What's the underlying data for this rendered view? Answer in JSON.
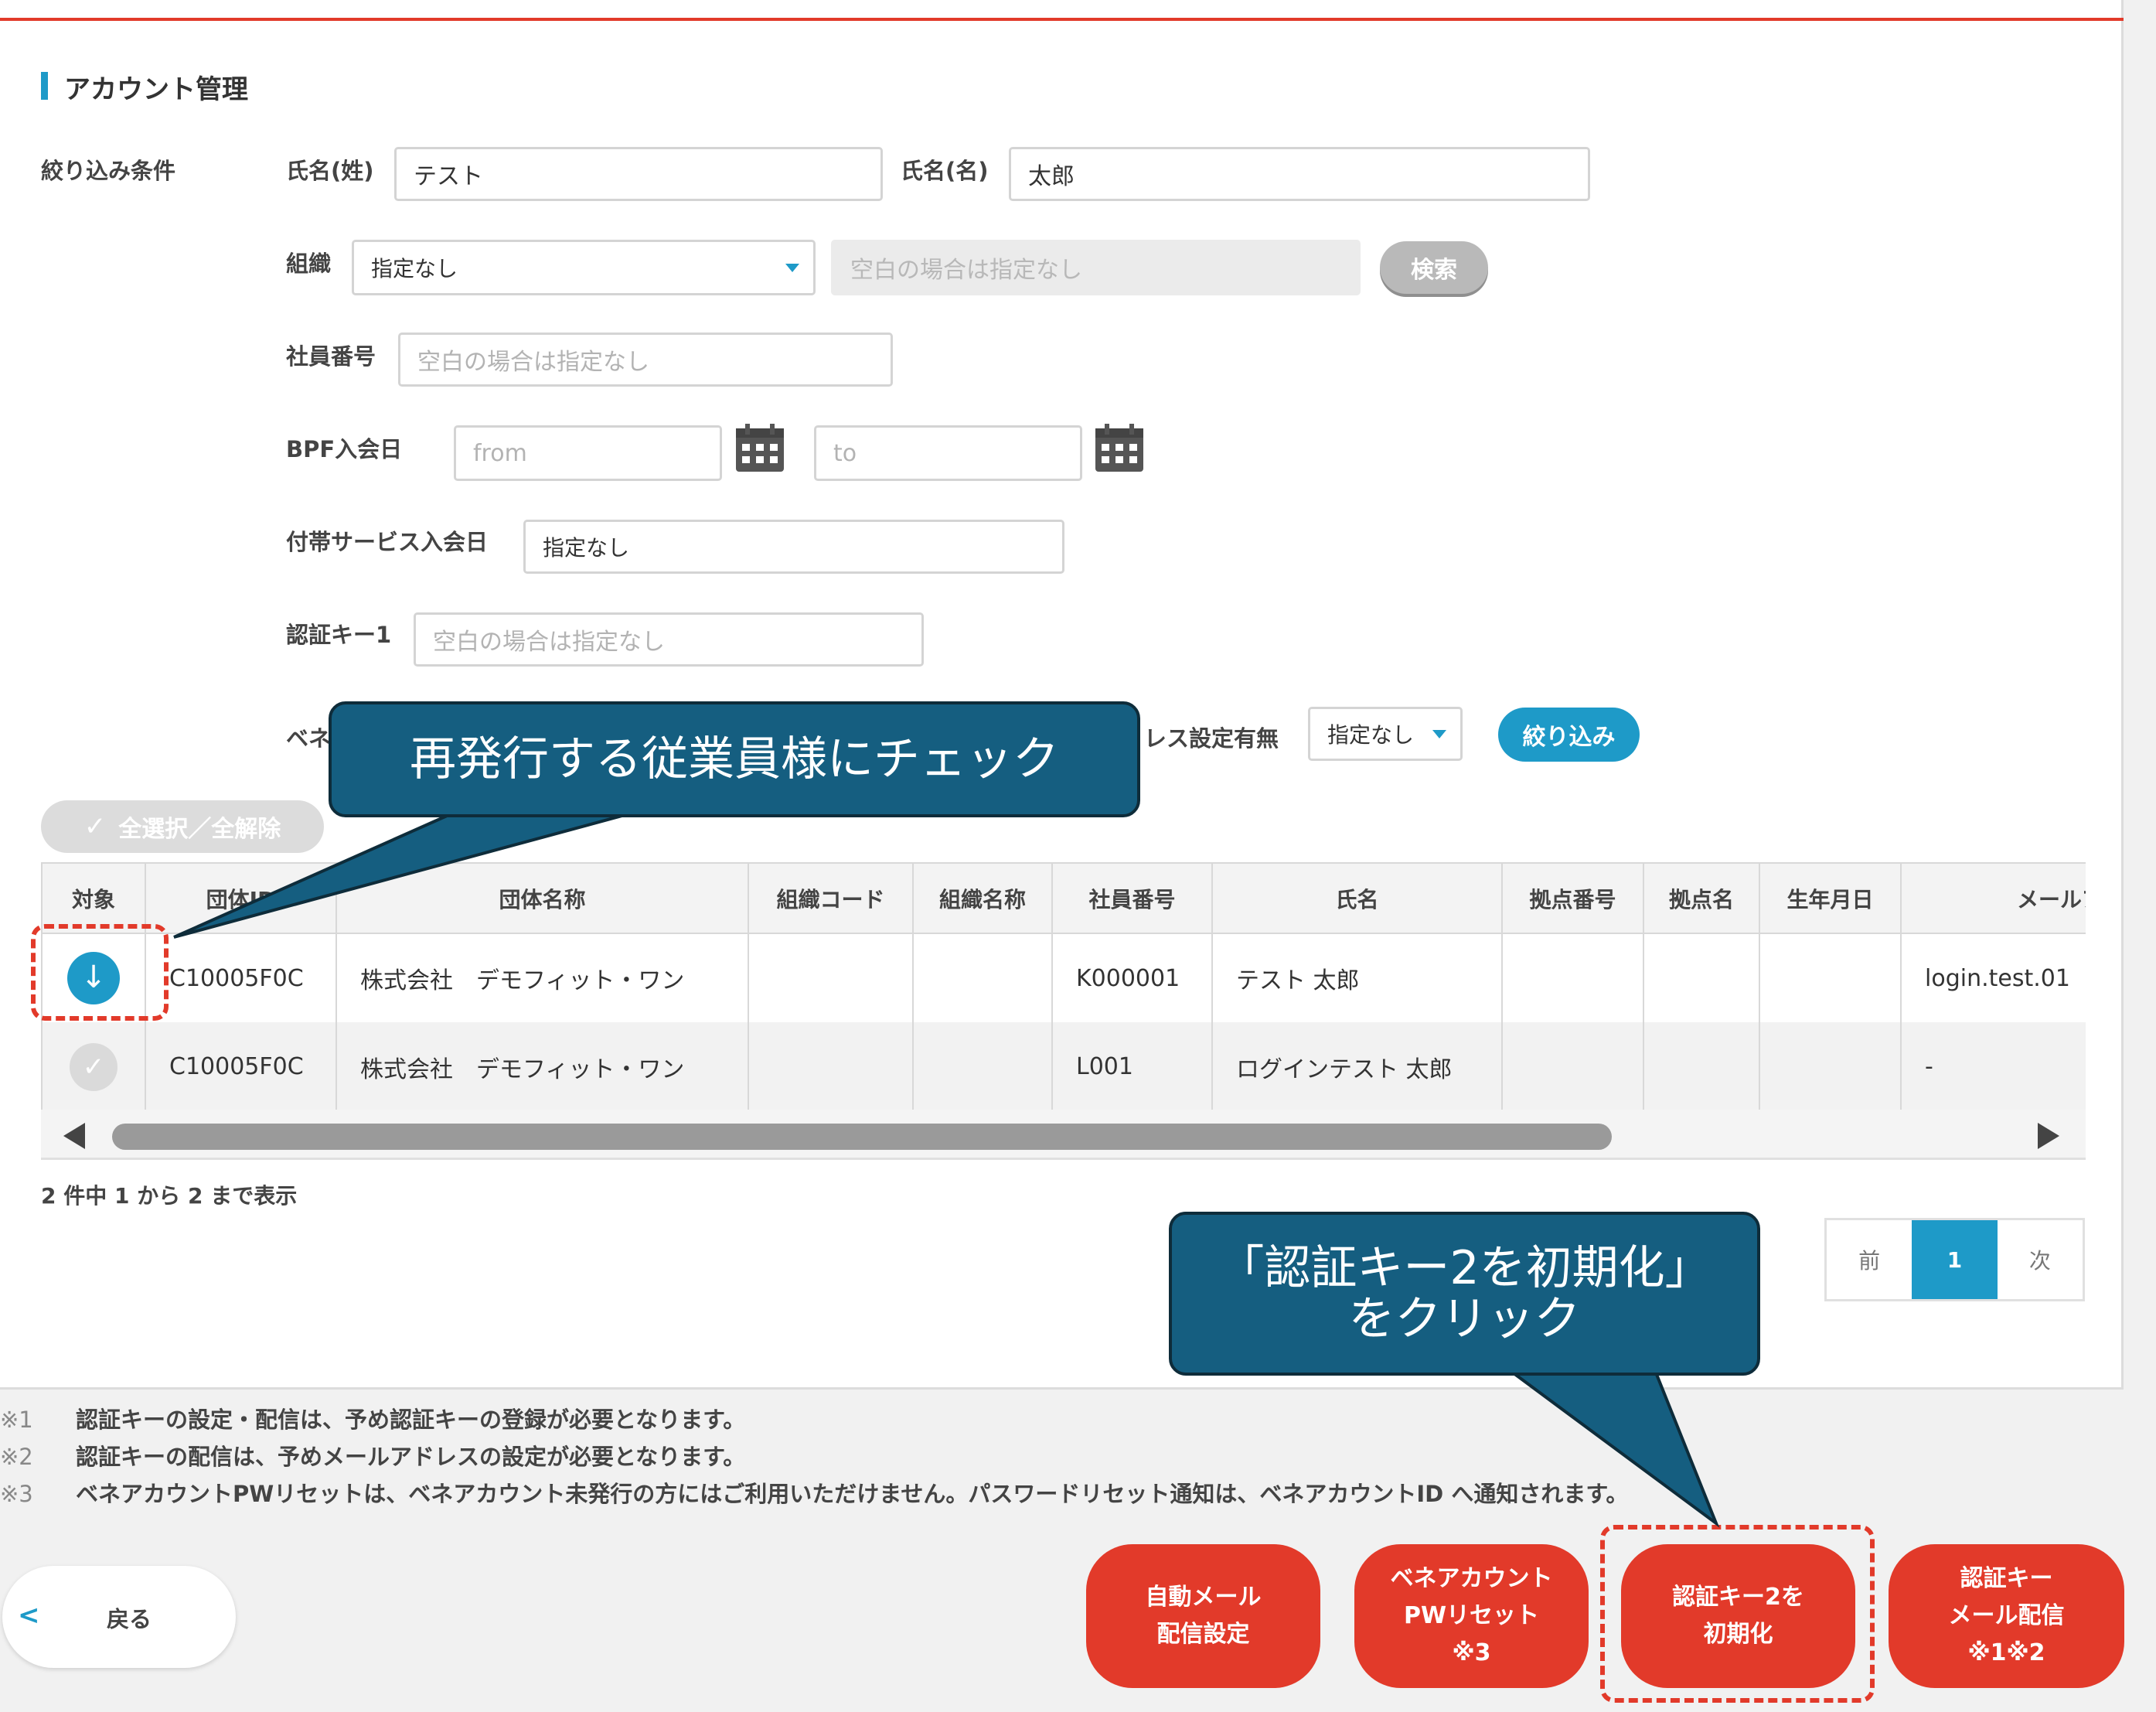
{
  "page": {
    "title": "アカウント管理"
  },
  "filter": {
    "section_label": "絞り込み条件",
    "last_name_label": "氏名(姓)",
    "last_name_value": "テスト",
    "first_name_label": "氏名(名)",
    "first_name_value": "太郎",
    "org_label": "組織",
    "org_select": "指定なし",
    "org_search_placeholder": "空白の場合は指定なし",
    "search_button": "検索",
    "employee_no_label": "社員番号",
    "employee_no_placeholder": "空白の場合は指定なし",
    "bpf_join_label": "BPF入会日",
    "date_from_placeholder": "from",
    "date_to_placeholder": "to",
    "service_join_label": "付帯サービス入会日",
    "service_join_value": "指定なし",
    "auth_key_label": "認証キー1",
    "auth_key_placeholder": "空白の場合は指定なし",
    "bene_label_partial": "ベネ",
    "address_setting_label_partial": "レス設定有無",
    "address_setting_select": "指定なし",
    "apply_button": "絞り込み",
    "select_all_button": "全選択／全解除"
  },
  "table": {
    "columns": [
      "対象",
      "団体ID",
      "団体名称",
      "組織コード",
      "組織名称",
      "社員番号",
      "氏名",
      "拠点番号",
      "拠点名",
      "生年月日",
      "メールアドレス"
    ],
    "rows": [
      {
        "checked": true,
        "org_id": "C10005F0C",
        "org_name": "株式会社　デモフィット・ワン",
        "dept_code": "",
        "dept_name": "",
        "emp_no": "K000001",
        "name": "テスト 太郎",
        "site_no": "",
        "site_name": "",
        "birth": "",
        "email": "login.test.01"
      },
      {
        "checked": false,
        "org_id": "C10005F0C",
        "org_name": "株式会社　デモフィット・ワン",
        "dept_code": "",
        "dept_name": "",
        "emp_no": "L001",
        "name": "ログインテスト 太郎",
        "site_no": "",
        "site_name": "",
        "birth": "",
        "email": "-"
      }
    ]
  },
  "result_count": "2 件中 1 から 2 まで表示",
  "pagination": {
    "prev": "前",
    "current": "1",
    "next": "次"
  },
  "notes": [
    {
      "mark": "※1",
      "text": "認証キーの設定・配信は、予め認証キーの登録が必要となります。"
    },
    {
      "mark": "※2",
      "text": "認証キーの配信は、予めメールアドレスの設定が必要となります。"
    },
    {
      "mark": "※3",
      "text": "ベネアカウントPWリセットは、ベネアカウント未発行の方にはご利用いただけません。パスワードリセット通知は、ベネアカウントID へ通知されます。"
    }
  ],
  "actions": {
    "back": "戻る",
    "auto_mail": "自動メール\n配信設定",
    "pw_reset": "ベネアカウント\nPWリセット\n※3",
    "init_key2": "認証キー2を\n初期化",
    "key_mail": "認証キー\nメール配信\n※1※2"
  },
  "callouts": {
    "check_employee": "再発行する従業員様にチェック",
    "click_init": "「認証キー2を初期化」\nをクリック"
  },
  "colors": {
    "accent": "#1e9ac8",
    "brand_red": "#e23a2a",
    "callout": "#155e80"
  },
  "icons": {
    "calendar": "calendar-icon",
    "back": "chevron-left-icon",
    "check": "check-icon"
  }
}
